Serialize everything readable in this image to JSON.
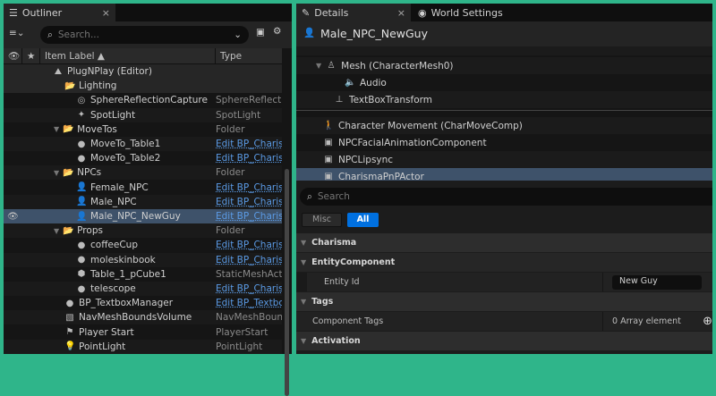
{
  "outliner": {
    "tab_label": "Outliner",
    "close": "×",
    "search_placeholder": "Search...",
    "columns": {
      "label": "Item Label ▲",
      "type": "Type"
    },
    "rows": [
      {
        "label": "PlugNPlay (Editor)",
        "type": "",
        "icon": "level-icon",
        "indent": 0,
        "pinned": true
      },
      {
        "label": "Lighting",
        "type": "",
        "icon": "folder-icon",
        "indent": 1,
        "pinned": true
      },
      {
        "label": "SphereReflectionCapture",
        "type": "SphereReflectionCapture",
        "icon": "sphere-capture-icon",
        "indent": 2
      },
      {
        "label": "SpotLight",
        "type": "SpotLight",
        "icon": "spotlight-icon",
        "indent": 2
      },
      {
        "label": "MoveTos",
        "type": "Folder",
        "icon": "folder-icon",
        "indent": 1,
        "expanded": true
      },
      {
        "label": "MoveTo_Table1",
        "type": "Edit BP_CharismaPnPActor",
        "link": true,
        "icon": "actor-icon",
        "indent": 2
      },
      {
        "label": "MoveTo_Table2",
        "type": "Edit BP_CharismaPnPActor",
        "link": true,
        "icon": "actor-icon",
        "indent": 2
      },
      {
        "label": "NPCs",
        "type": "Folder",
        "icon": "folder-icon",
        "indent": 1,
        "expanded": true
      },
      {
        "label": "Female_NPC",
        "type": "Edit BP_CharismaPnPActor",
        "link": true,
        "icon": "character-icon",
        "indent": 2
      },
      {
        "label": "Male_NPC",
        "type": "Edit BP_CharismaPnPActor",
        "link": true,
        "icon": "character-icon",
        "indent": 2
      },
      {
        "label": "Male_NPC_NewGuy",
        "type": "Edit BP_CharismaPnPActor",
        "link": true,
        "icon": "character-icon",
        "indent": 2,
        "selected": true
      },
      {
        "label": "Props",
        "type": "Folder",
        "icon": "folder-icon",
        "indent": 1,
        "expanded": true
      },
      {
        "label": "coffeeCup",
        "type": "Edit BP_CharismaPnPActor",
        "link": true,
        "icon": "actor-icon",
        "indent": 2
      },
      {
        "label": "moleskinbook",
        "type": "Edit BP_CharismaPnPActor",
        "link": true,
        "icon": "actor-icon",
        "indent": 2
      },
      {
        "label": "Table_1_pCube1",
        "type": "StaticMeshActor",
        "icon": "static-mesh-icon",
        "indent": 2
      },
      {
        "label": "telescope",
        "type": "Edit BP_CharismaPnPActor",
        "link": true,
        "icon": "actor-icon",
        "indent": 2
      },
      {
        "label": "BP_TextboxManager",
        "type": "Edit BP_TextboxManager",
        "link": true,
        "icon": "actor-icon",
        "indent": 1
      },
      {
        "label": "NavMeshBoundsVolume",
        "type": "NavMeshBoundsVolume",
        "icon": "volume-icon",
        "indent": 1
      },
      {
        "label": "Player Start",
        "type": "PlayerStart",
        "icon": "player-start-icon",
        "indent": 1
      },
      {
        "label": "PointLight",
        "type": "PointLight",
        "icon": "pointlight-icon",
        "indent": 1
      }
    ]
  },
  "details": {
    "tab_label": "Details",
    "close": "×",
    "world_tab": "World Settings",
    "title": "Male_NPC_NewGuy",
    "components": [
      {
        "label": "Mesh (CharacterMesh0)",
        "icon": "skeletal-mesh-icon",
        "indent": 1
      },
      {
        "label": "Audio",
        "icon": "audio-icon",
        "indent": 2
      },
      {
        "label": "TextBoxTransform",
        "icon": "scene-component-icon",
        "indent": 1
      },
      {
        "label": "Character Movement (CharMoveComp)",
        "icon": "movement-icon",
        "indent": 0
      },
      {
        "label": "NPCFacialAnimationComponent",
        "icon": "component-icon",
        "indent": 0
      },
      {
        "label": "NPCLipsync",
        "icon": "component-icon",
        "indent": 0
      },
      {
        "label": "CharismaPnPActor",
        "icon": "component-icon",
        "indent": 0,
        "selected": true
      }
    ],
    "search_placeholder": "Search",
    "filters": [
      {
        "label": "Misc",
        "active": false
      },
      {
        "label": "All",
        "active": true
      }
    ],
    "sections": {
      "charisma": "Charisma",
      "entity": "EntityComponent",
      "entity_id_label": "Entity Id",
      "entity_id_value": "New Guy",
      "tags": "Tags",
      "component_tags_label": "Component Tags",
      "component_tags_value": "0 Array element",
      "activation": "Activation"
    },
    "accent": "#0070e0",
    "selection": "#3e526a"
  }
}
